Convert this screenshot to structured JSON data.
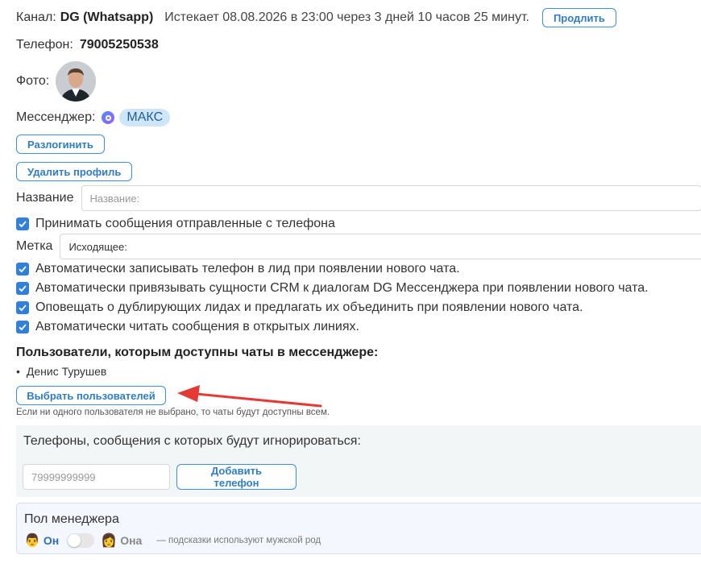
{
  "channel": {
    "label": "Канал:",
    "name": "DG (Whatsapp)",
    "expires": "Истекает 08.08.2026 в 23:00 через 3 дней 10 часов 25 минут.",
    "extend_button": "Продлить"
  },
  "phone": {
    "label": "Телефон:",
    "value": "79005250538"
  },
  "photo": {
    "label": "Фото:"
  },
  "messenger": {
    "label": "Мессенджер:",
    "icon": "max-messenger-icon",
    "name": "МАКС"
  },
  "buttons": {
    "logout": "Разлогинить",
    "delete_profile": "Удалить профиль"
  },
  "name_field": {
    "label": "Название",
    "placeholder": "Название:"
  },
  "accept_messages": "Принимать сообщения отправленные с телефона",
  "tag_field": {
    "label": "Метка",
    "value": "Исходящее:"
  },
  "options": [
    "Автоматически записывать телефон в лид при появлении нового чата.",
    "Автоматически привязывать сущности CRM к диалогам DG Мессенджера при появлении нового чата.",
    "Оповещать о дублирующих лидах и предлагать их объединить при появлении нового чата.",
    "Автоматически читать сообщения в открытых линиях."
  ],
  "users": {
    "heading": "Пользователи, которым доступны чаты в мессенджере:",
    "list": [
      "Денис Турушев"
    ],
    "select_button": "Выбрать пользователей",
    "hint": "Если ни одного пользователя не выбрано, то чаты будут доступны всем."
  },
  "ignore_phones": {
    "title": "Телефоны, сообщения с которых будут игнорироваться:",
    "placeholder": "79999999999",
    "add_button": "Добавить телефон"
  },
  "manager_gender": {
    "title": "Пол менеджера",
    "male": "Он",
    "female": "Она",
    "note": "— подсказки используют мужской род",
    "toggle_on": false
  },
  "colors": {
    "accent": "#2f80d8",
    "arrow": "#e53935",
    "pill": "#cfe6f9"
  }
}
